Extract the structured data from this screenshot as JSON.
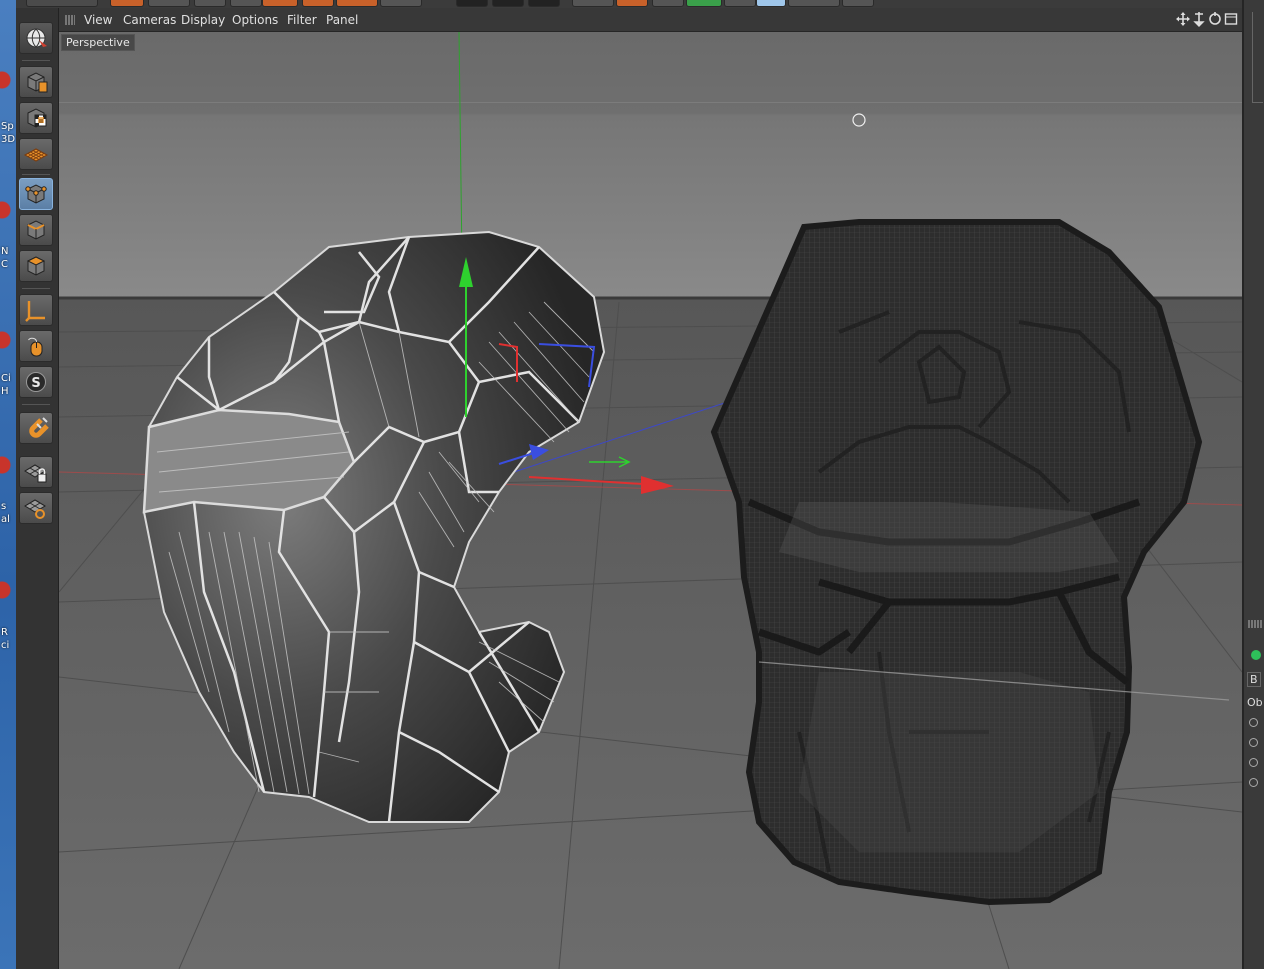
{
  "menu": {
    "items": [
      "View",
      "Cameras",
      "Display",
      "Options",
      "Filter",
      "Panel"
    ]
  },
  "viewport": {
    "camera_label": "Perspective"
  },
  "desktop_labels": [
    "Sp\n3D",
    "N\nC",
    "Ci\nH",
    "s\nal",
    "R\nci"
  ],
  "right_panel": {
    "tab_label": "B",
    "section_label": "Ob"
  },
  "palette": {
    "tools": [
      "model-mode-icon",
      "texture-mode-icon",
      "workplane-mode-icon",
      "points-mode-icon",
      "edges-mode-icon",
      "polygons-mode-icon",
      "axis-mode-icon",
      "tweak-mode-icon",
      "snap-icon",
      "magnet-icon",
      "lock-workplane-icon",
      "planar-workplane-icon"
    ]
  },
  "colors": {
    "axis_x": "#e03030",
    "axis_y": "#22c12a",
    "axis_z": "#3a4ee0",
    "accent_orange": "#e8922a",
    "wire_light": "#dcdcdc"
  }
}
